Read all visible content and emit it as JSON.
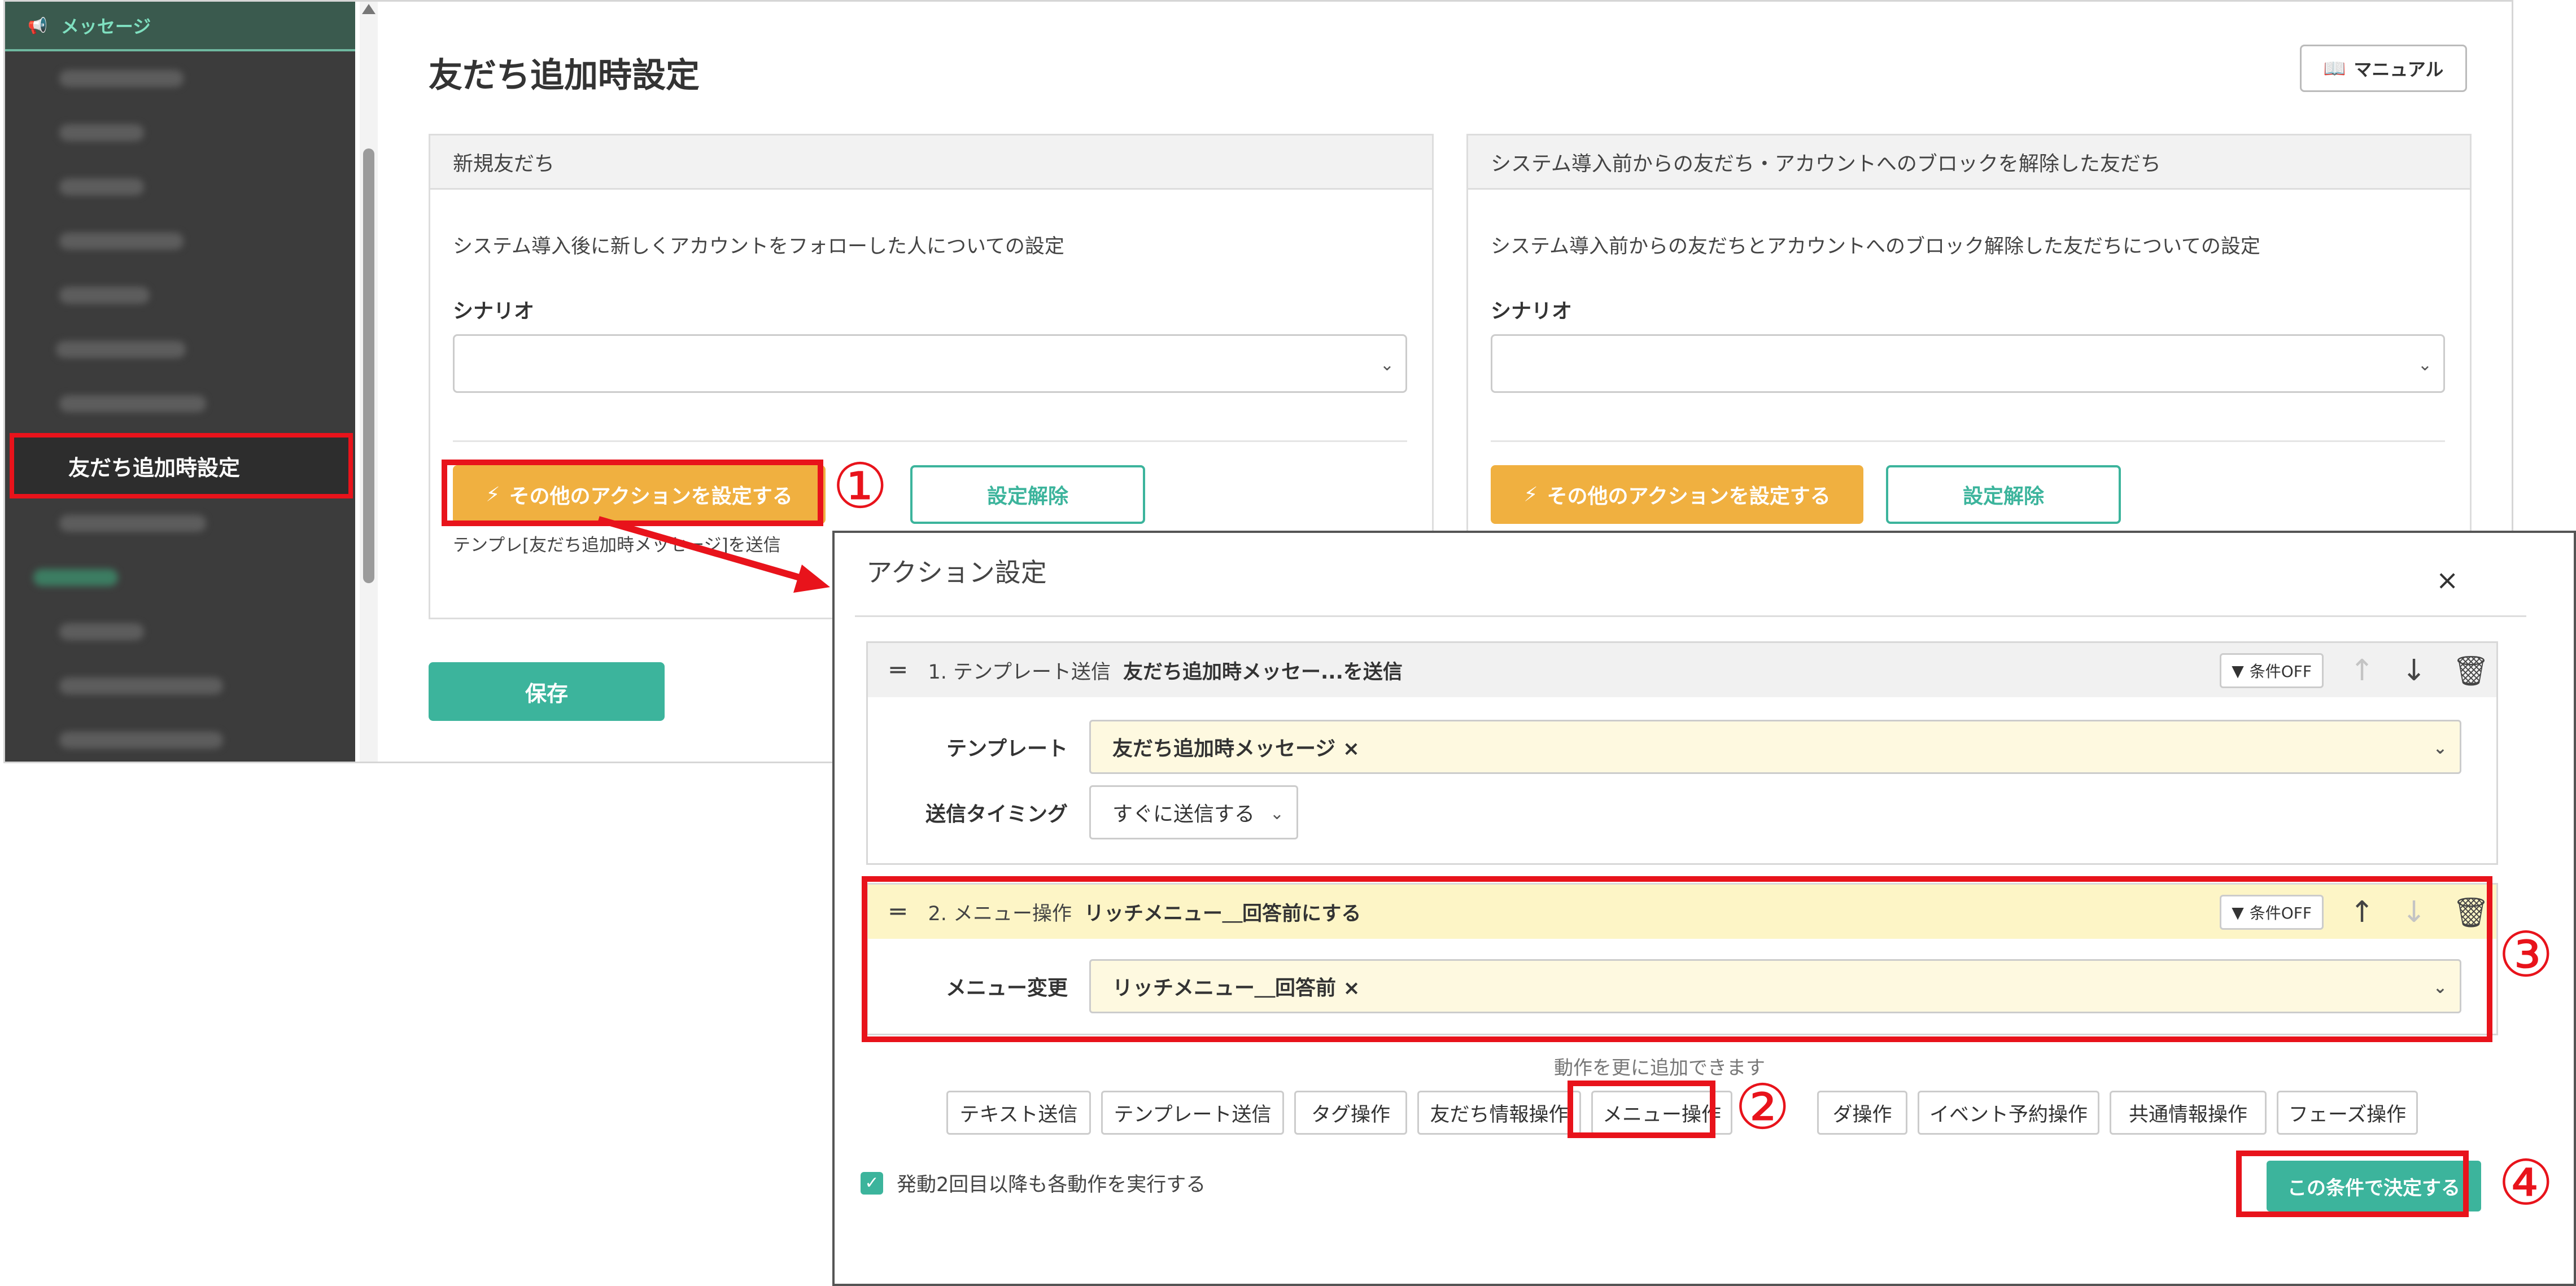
{
  "sidebar": {
    "section_label": "メッセージ",
    "section_icon": "megaphone-icon",
    "active_item": "友だち追加時設定"
  },
  "page": {
    "title": "友だち追加時設定",
    "manual_label": "マニュアル",
    "save_label": "保存"
  },
  "panels": [
    {
      "header": "新規友だち",
      "description": "システム導入後に新しくアカウントをフォローした人についての設定",
      "scenario_label": "シナリオ",
      "scenario_value": "",
      "action_button": "その他のアクションを設定する",
      "release_button": "設定解除",
      "note": "テンプレ[友だち追加時メッセージ]を送信"
    },
    {
      "header": "システム導入前からの友だち・アカウントへのブロックを解除した友だち",
      "description": "システム導入前からの友だちとアカウントへのブロック解除した友だちについての設定",
      "scenario_label": "シナリオ",
      "scenario_value": "",
      "action_button": "その他のアクションを設定する",
      "release_button": "設定解除"
    }
  ],
  "modal": {
    "title": "アクション設定",
    "close": "×",
    "actions": [
      {
        "number": "1. テンプレート送信",
        "title": "友だち追加時メッセー...を送信",
        "condition": "条件OFF",
        "fields": [
          {
            "label": "テンプレート",
            "value": "友だち追加時メッセージ ×"
          },
          {
            "label": "送信タイミング",
            "value": "すぐに送信する"
          }
        ]
      },
      {
        "number": "2. メニュー操作",
        "title": "リッチメニュー＿回答前にする",
        "condition": "条件OFF",
        "fields": [
          {
            "label": "メニュー変更",
            "value": "リッチメニュー＿回答前 ×"
          }
        ]
      }
    ],
    "add_label": "動作を更に追加できます",
    "add_buttons": [
      "テキスト送信",
      "テンプレート送信",
      "タグ操作",
      "友だち情報操作",
      "メニュー操作",
      "ダ操作",
      "イベント予約操作",
      "共通情報操作",
      "フェーズ操作"
    ],
    "repeat_label": "発動2回目以降も各動作を実行する",
    "repeat_checked": true,
    "decide_label": "この条件で決定する"
  },
  "callouts": [
    "①",
    "②",
    "③",
    "④"
  ],
  "colors": {
    "accent": "#3cb49c",
    "action_orange": "#f0b040",
    "highlight_red": "#e8131b"
  }
}
